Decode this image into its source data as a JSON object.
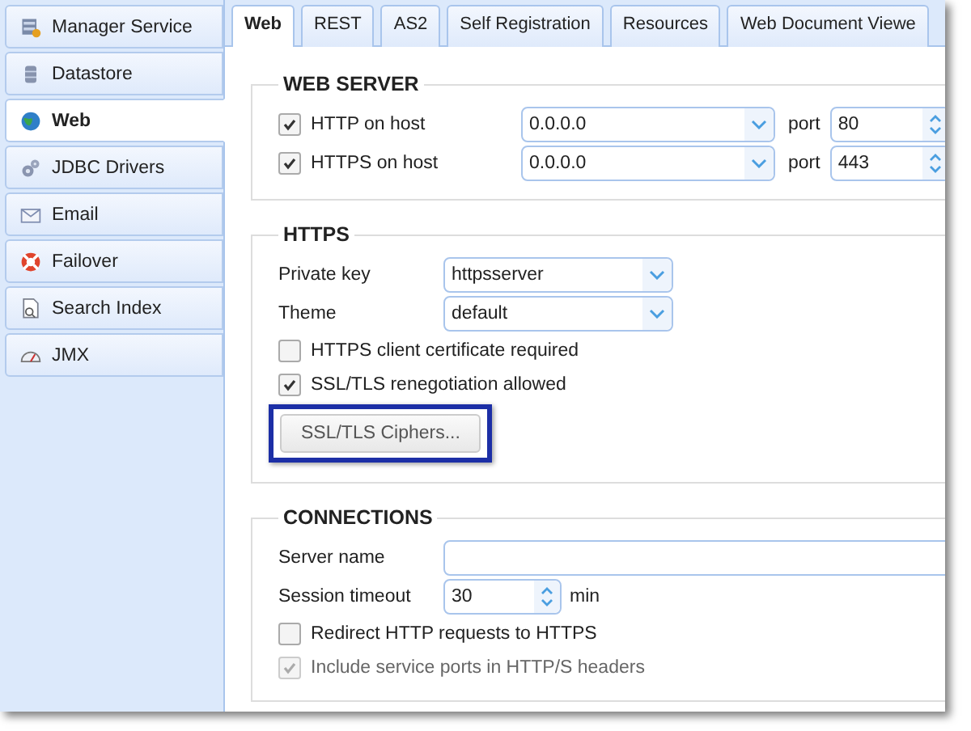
{
  "sidebar": {
    "items": [
      {
        "label": "Manager Service",
        "selected": false
      },
      {
        "label": "Datastore",
        "selected": false
      },
      {
        "label": "Web",
        "selected": true
      },
      {
        "label": "JDBC Drivers",
        "selected": false
      },
      {
        "label": "Email",
        "selected": false
      },
      {
        "label": "Failover",
        "selected": false
      },
      {
        "label": "Search Index",
        "selected": false
      },
      {
        "label": "JMX",
        "selected": false
      }
    ]
  },
  "tabs": [
    {
      "label": "Web",
      "selected": true
    },
    {
      "label": "REST",
      "selected": false
    },
    {
      "label": "AS2",
      "selected": false
    },
    {
      "label": "Self Registration",
      "selected": false
    },
    {
      "label": "Resources",
      "selected": false
    },
    {
      "label": "Web Document Viewe",
      "selected": false
    }
  ],
  "sections": [
    {
      "title": "WEB SERVER",
      "rows": [
        {
          "kind": "host",
          "label": "HTTP on host",
          "checked": true,
          "value": "0.0.0.0",
          "port_label": "port",
          "port": "80"
        },
        {
          "kind": "host",
          "label": "HTTPS on host",
          "checked": true,
          "value": "0.0.0.0",
          "port_label": "port",
          "port": "443"
        }
      ]
    },
    {
      "title": "HTTPS",
      "rows": [
        {
          "kind": "select",
          "label": "Private key",
          "value": "httpsserver"
        },
        {
          "kind": "select",
          "label": "Theme",
          "value": "default"
        },
        {
          "kind": "checkbox",
          "label": "HTTPS client certificate required",
          "checked": false,
          "disabled": false
        },
        {
          "kind": "checkbox",
          "label": "SSL/TLS renegotiation allowed",
          "checked": true,
          "disabled": false
        },
        {
          "kind": "button",
          "label": "SSL/TLS Ciphers...",
          "highlighted": true
        }
      ]
    },
    {
      "title": "CONNECTIONS",
      "rows": [
        {
          "kind": "text",
          "label": "Server name"
        },
        {
          "kind": "spinner",
          "label": "Session timeout",
          "value": "30",
          "unit": "min"
        },
        {
          "kind": "checkbox",
          "label": "Redirect HTTP requests to HTTPS",
          "checked": false,
          "disabled": false
        },
        {
          "kind": "checkbox",
          "label": "Include service ports in HTTP/S headers",
          "checked": true,
          "disabled": true
        }
      ]
    }
  ]
}
